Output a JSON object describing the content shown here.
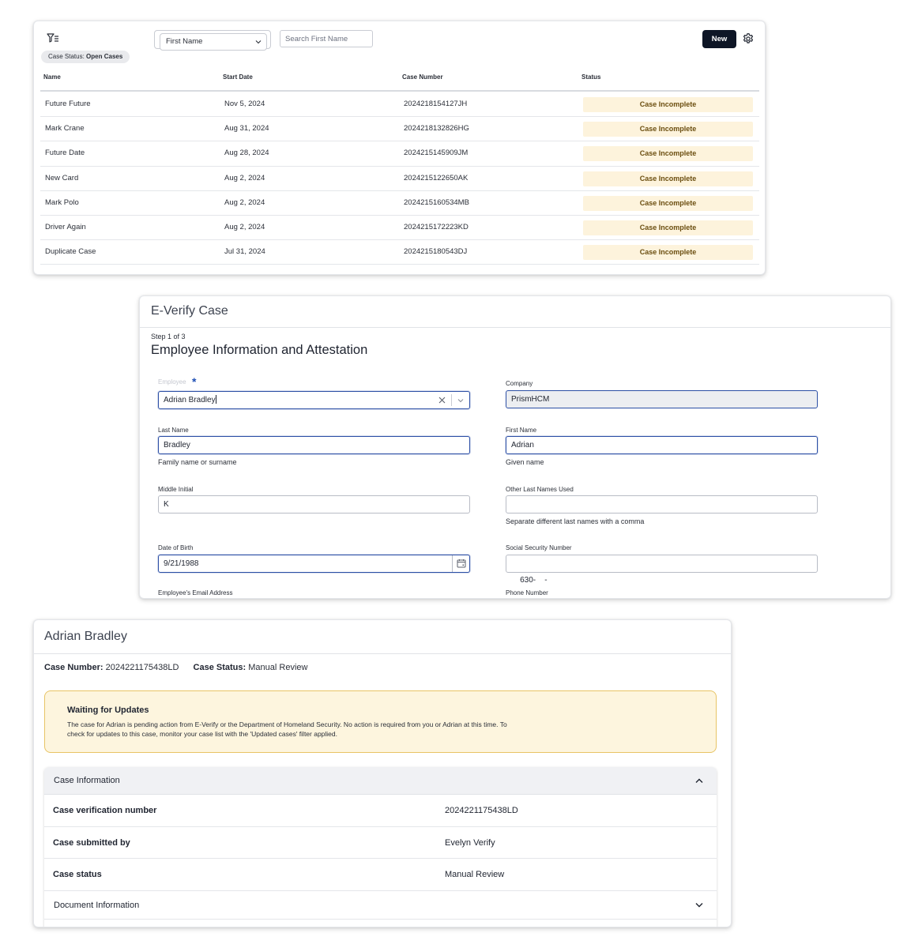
{
  "case_list": {
    "filter_field": "First Name",
    "search_placeholder": "Search First Name",
    "new_button": "New",
    "status_chip": {
      "label": "Case Status:",
      "value": "Open Cases"
    },
    "columns": [
      "Name",
      "Start Date",
      "Case Number",
      "Status"
    ],
    "rows": [
      {
        "name": "Future Future",
        "start_date": "Nov 5, 2024",
        "case_number": "2024218154127JH",
        "status": "Case Incomplete"
      },
      {
        "name": "Mark Crane",
        "start_date": "Aug 31, 2024",
        "case_number": "2024218132826HG",
        "status": "Case Incomplete"
      },
      {
        "name": "Future Date",
        "start_date": "Aug 28, 2024",
        "case_number": "2024215145909JM",
        "status": "Case Incomplete"
      },
      {
        "name": "New Card",
        "start_date": "Aug 2, 2024",
        "case_number": "2024215122650AK",
        "status": "Case Incomplete"
      },
      {
        "name": "Mark Polo",
        "start_date": "Aug 2, 2024",
        "case_number": "2024215160534MB",
        "status": "Case Incomplete"
      },
      {
        "name": "Driver Again",
        "start_date": "Aug 2, 2024",
        "case_number": "2024215172223KD",
        "status": "Case Incomplete"
      },
      {
        "name": "Duplicate Case",
        "start_date": "Jul 31, 2024",
        "case_number": "2024215180543DJ",
        "status": "Case Incomplete"
      }
    ]
  },
  "everify_form": {
    "title": "E-Verify Case",
    "step": "Step 1 of 3",
    "section_title": "Employee Information and Attestation",
    "employee": {
      "label": "Employee",
      "value": "Adrian Bradley"
    },
    "company": {
      "label": "Company",
      "value": "PrismHCM"
    },
    "last_name": {
      "label": "Last Name",
      "value": "Bradley",
      "hint": "Family name or surname"
    },
    "first_name": {
      "label": "First Name",
      "value": "Adrian",
      "hint": "Given name"
    },
    "middle_initial": {
      "label": "Middle Initial",
      "value": "K"
    },
    "other_last_names": {
      "label": "Other Last Names Used",
      "value": "",
      "hint": "Separate different last names with a comma"
    },
    "dob": {
      "label": "Date of Birth",
      "value": "9/21/1988"
    },
    "ssn": {
      "label": "Social Security Number",
      "value": "630-    -"
    },
    "email": {
      "label": "Employee's Email Address"
    },
    "phone": {
      "label": "Phone Number"
    }
  },
  "case_detail": {
    "title": "Adrian Bradley",
    "case_number_label": "Case Number:",
    "case_number": "2024221175438LD",
    "case_status_label": "Case Status:",
    "case_status": "Manual Review",
    "alert": {
      "title": "Waiting for Updates",
      "body": "The case for Adrian is pending action from E-Verify or the Department of Homeland Security. No action is required from you or Adrian at this time. To check for updates to this case, monitor your case list with the 'Updated cases' filter applied."
    },
    "case_information": {
      "title": "Case Information",
      "rows": [
        {
          "label": "Case verification number",
          "value": "2024221175438LD"
        },
        {
          "label": "Case submitted by",
          "value": "Evelyn Verify"
        },
        {
          "label": "Case status",
          "value": "Manual Review"
        }
      ]
    },
    "document_information_title": "Document Information"
  },
  "icons": {
    "filter": "filter-list-icon",
    "settings": "gear-icon",
    "dropdown": "chevron-down-icon",
    "clear": "close-icon",
    "calendar": "calendar-icon",
    "collapse": "chevron-up-icon"
  },
  "colors": {
    "primary_button": "#0e1626",
    "status_badge_bg": "#fdf3dc",
    "alert_bg": "#fdf5de",
    "alert_border": "#e8c465",
    "focus_border": "#2c4fa5",
    "required_mark": "#1e4fb5"
  }
}
